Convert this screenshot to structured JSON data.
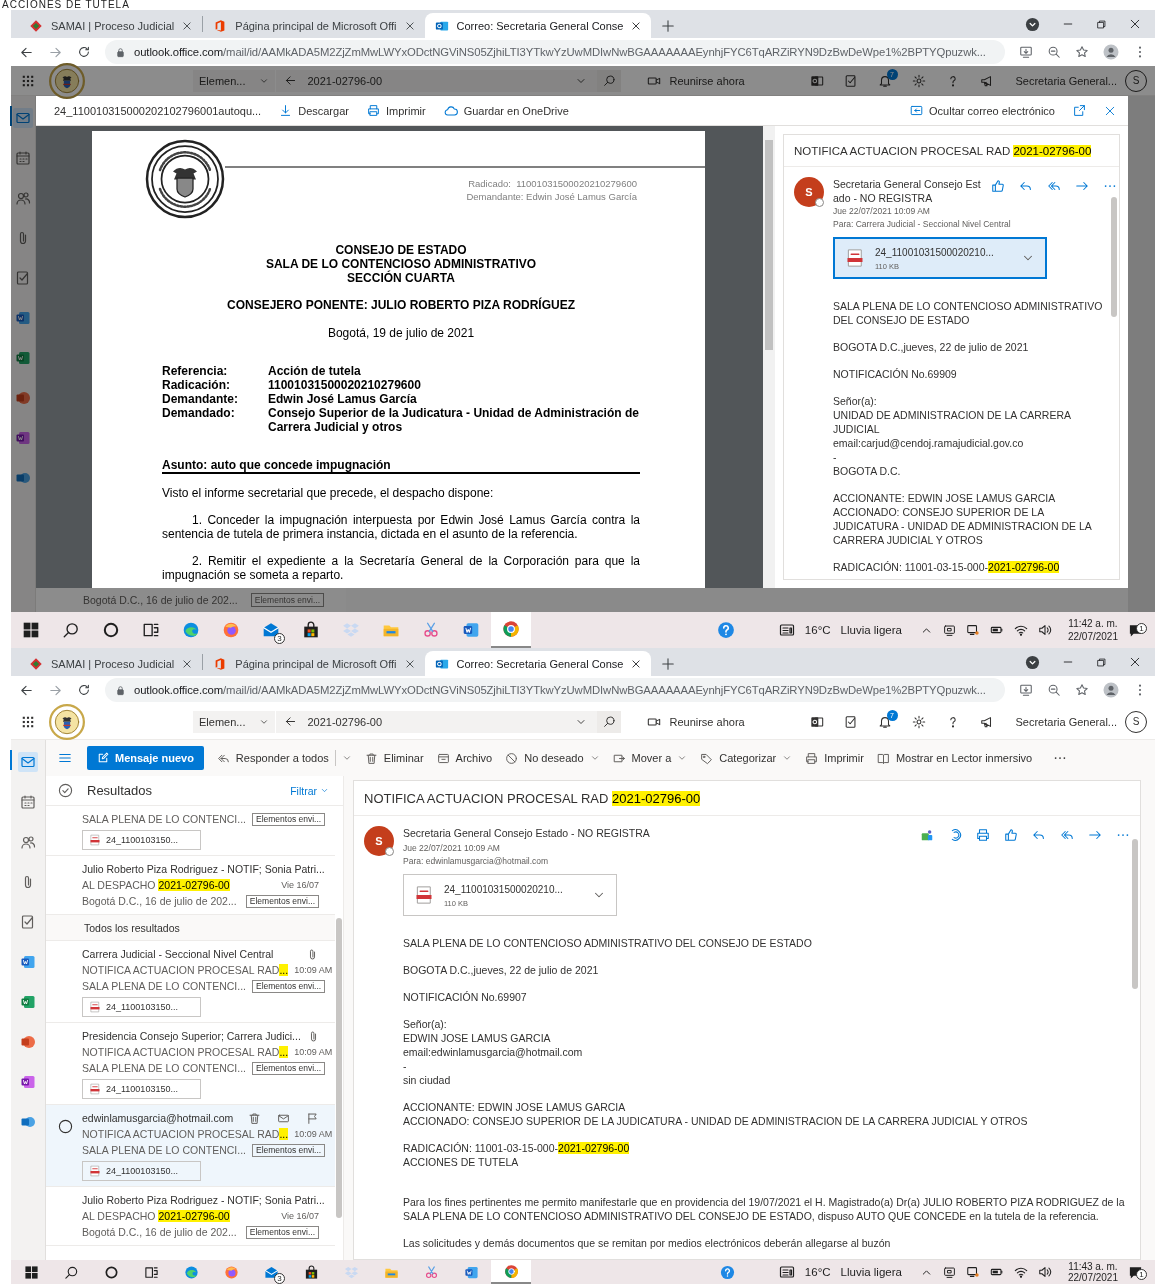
{
  "caption": "ACCIONES DE TUTELA",
  "screens": [
    {
      "browser": {
        "tabs": [
          {
            "label": "SAMAI | Proceso Judicial",
            "selected": false
          },
          {
            "label": "Página principal de Microsoft Offi",
            "selected": false
          },
          {
            "label": "Correo: Secretaria General Conse",
            "selected": true
          }
        ],
        "url_host": "outlook.office.com",
        "url_path": "/mail/id/AAMkADA5M2ZjZmMwLWYxODctNGViNS05ZjhiLTI3YTkwYzUwMDIwNwBGAAAAAAAEynhjFYC6TqARZiRYN9DzBwDeWpe1%2BPTYQpuzwk..."
      },
      "outlook": {
        "dimmed": true,
        "scope": "Elemen...",
        "search": "2021-02796-00",
        "meet": "Reunirse ahora",
        "notification_count": "7",
        "account": "Secretaria General...",
        "avatar": "S",
        "rail": [
          {
            "kind": "mail",
            "selected": true
          },
          {
            "kind": "calendar",
            "selected": false
          },
          {
            "kind": "people",
            "selected": false
          },
          {
            "kind": "files",
            "selected": false
          },
          {
            "kind": "todo",
            "selected": false
          },
          {
            "kind": "word",
            "selected": false
          },
          {
            "kind": "excel",
            "selected": false
          },
          {
            "kind": "powerpoint",
            "selected": false
          },
          {
            "kind": "onenote",
            "selected": false
          },
          {
            "kind": "yammer",
            "selected": false
          }
        ]
      },
      "viewer": {
        "file_name": "24_110010315000202102796001autoqu...",
        "download": "Descargar",
        "print": "Imprimir",
        "save": "Guardar en OneDrive",
        "hide_mail": "Ocultar correo electrónico",
        "pdf": {
          "radicado": "Radicado:  11001031500020210279600",
          "demandante": "Demandante: Edwin José Lamus García",
          "heading": [
            "CONSEJO DE ESTADO",
            "SALA DE LO CONTENCIOSO ADMINISTRATIVO",
            "SECCIÓN CUARTA"
          ],
          "ponente": "CONSEJERO PONENTE: JULIO ROBERTO PIZA RODRÍGUEZ",
          "date": "Bogotá, 19 de julio de 2021",
          "references": [
            {
              "label": "Referencia:",
              "value": "Acción de tutela"
            },
            {
              "label": "Radicación:",
              "value": "11001031500020210279600"
            },
            {
              "label": "Demandante:",
              "value": "Edwin José Lamus García"
            },
            {
              "label": "Demandado:",
              "value": "Consejo Superior de la Judicatura - Unidad de Administración de Carrera Judicial y otros"
            }
          ],
          "subject": "Asunto: auto que concede impugnación",
          "intro": "Visto el informe secretarial que precede, el despacho dispone:",
          "items": [
            {
              "number": "1.",
              "text": "Conceder la impugnación interpuesta por Edwin José Lamus García contra la sentencia de tutela de primera instancia, dictada en el asunto de la referencia."
            },
            {
              "number": "2.",
              "text": "Remitir el expediente a la Secretaría General de la Corporación para que la impugnación se someta a reparto."
            }
          ]
        },
        "mail": {
          "title": [
            {
              "text": "NOTIFICA ACTUACION PROCESAL RAD ",
              "highlighted": false
            },
            {
              "text": "2021-02796-00",
              "highlighted": true
            }
          ],
          "sender": "Secretaria General Consejo Estado - NO REGISTRA",
          "avatar": "S",
          "date": "Jue 22/07/2021 10:09 AM",
          "to_label": "Para:",
          "to": "Carrera Judicial - Seccional Nivel Central",
          "attachment": {
            "name": "24_11001031500020210...",
            "size": "110 KB",
            "selected": true
          },
          "paragraphs": [
            [
              [
                {
                  "text": "SALA PLENA DE LO CONTENCIOSO ADMINISTRATIVO DEL CONSEJO DE ESTADO",
                  "highlighted": false
                }
              ]
            ],
            [
              [
                {
                  "text": "BOGOTA D.C.,jueves, 22 de julio de 2021",
                  "highlighted": false
                }
              ]
            ],
            [
              [
                {
                  "text": "NOTIFICACIÓN No.69909",
                  "highlighted": false
                }
              ]
            ],
            [
              [
                {
                  "text": "Señor(a):",
                  "highlighted": false
                }
              ],
              [
                {
                  "text": "UNIDAD DE ADMINISTRACION DE LA CARRERA JUDICIAL",
                  "highlighted": false
                }
              ],
              [
                {
                  "text": "email:carjud@cendoj.ramajudicial.gov.co",
                  "highlighted": false
                }
              ],
              [
                {
                  "text": "-",
                  "highlighted": false
                }
              ],
              [
                {
                  "text": "BOGOTA D.C.",
                  "highlighted": false
                }
              ]
            ],
            [
              [
                {
                  "text": "ACCIONANTE: EDWIN JOSE LAMUS GARCIA",
                  "highlighted": false
                }
              ],
              [
                {
                  "text": "ACCIONADO: CONSEJO SUPERIOR DE LA JUDICATURA - UNIDAD DE ADMINISTRACION DE LA CARRERA JUDICIAL Y OTROS",
                  "highlighted": false
                }
              ]
            ],
            [
              [
                {
                  "text": "RADICACIÓN: 11001-03-15-000-",
                  "highlighted": false
                },
                {
                  "text": "2021-02796-00",
                  "highlighted": true
                }
              ]
            ]
          ]
        }
      },
      "peek": {
        "preview": "Bogotá D.C., 16 de julio de 202...",
        "folder": "Elementos envi..."
      },
      "taskbar": {
        "mail_badge": "3",
        "temperature": "16°C",
        "weather": "Lluvia ligera",
        "time": "11:42 a. m.",
        "date": "22/07/2021",
        "notification_badge": "1"
      }
    },
    {
      "browser": {
        "tabs": [
          {
            "label": "SAMAI | Proceso Judicial",
            "selected": false
          },
          {
            "label": "Página principal de Microsoft Offi",
            "selected": false
          },
          {
            "label": "Correo: Secretaria General Conse",
            "selected": true
          }
        ],
        "url_host": "outlook.office.com",
        "url_path": "/mail/id/AAMkADA5M2ZjZmMwLWYxODctNGViNS05ZjhiLTI3YTkwYzUwMDIwNwBGAAAAAAAEynhjFYC6TqARZiRYN9DzBwDeWpe1%2BPTYQpuzwk..."
      },
      "outlook": {
        "dimmed": false,
        "scope": "Elemen...",
        "search": "2021-02796-00",
        "meet": "Reunirse ahora",
        "notification_count": "7",
        "account": "Secretaria General...",
        "avatar": "S",
        "rail": [
          {
            "kind": "mail",
            "selected": true
          },
          {
            "kind": "calendar",
            "selected": false
          },
          {
            "kind": "people",
            "selected": false
          },
          {
            "kind": "files",
            "selected": false
          },
          {
            "kind": "todo",
            "selected": false
          },
          {
            "kind": "word",
            "selected": false
          },
          {
            "kind": "excel",
            "selected": false
          },
          {
            "kind": "powerpoint",
            "selected": false
          },
          {
            "kind": "onenote",
            "selected": false
          },
          {
            "kind": "yammer",
            "selected": false
          }
        ]
      },
      "command_bar": {
        "new_message": "Mensaje nuevo",
        "commands": [
          {
            "label": "Responder a todos",
            "menu": true
          },
          {
            "label": "Eliminar",
            "menu": false
          },
          {
            "label": "Archivo",
            "menu": false
          },
          {
            "label": "No deseado",
            "menu": true
          },
          {
            "label": "Mover a",
            "menu": true
          },
          {
            "label": "Categorizar",
            "menu": true
          },
          {
            "label": "Imprimir",
            "menu": false
          },
          {
            "label": "Mostrar en Lector inmersivo",
            "menu": false
          }
        ]
      },
      "list": {
        "title": "Resultados",
        "filter": "Filtrar",
        "items": [
          {
            "kind": "message",
            "selected": false,
            "preview": "SALA PLENA DE LO CONTENCI...",
            "folder": "Elementos envi...",
            "attachment": "24_1100103150..."
          },
          {
            "kind": "message",
            "selected": false,
            "sender": "Julio Roberto Piza Rodriguez - NOTIF; Sonia Patri...",
            "subject": [
              {
                "text": "AL DESPACHO ",
                "highlighted": false
              },
              {
                "text": "2021-02796-00",
                "highlighted": true
              }
            ],
            "time": "Vie 16/07",
            "preview": "Bogotá D.C., 16 de julio de 202...",
            "folder": "Elementos envi..."
          },
          {
            "kind": "section",
            "label": "Todos los resultados"
          },
          {
            "kind": "message",
            "selected": false,
            "clip": true,
            "sender": "Carrera Judicial - Seccional Nivel Central",
            "subject": [
              {
                "text": "NOTIFICA ACTUACION PROCESAL RAD",
                "highlighted": false
              },
              {
                "text": "...",
                "highlighted": true
              }
            ],
            "time": "10:09 AM",
            "preview": "SALA PLENA DE LO CONTENCI...",
            "folder": "Elementos envi...",
            "attachment": "24_1100103150..."
          },
          {
            "kind": "message",
            "selected": false,
            "clip": true,
            "sender": "Presidencia Consejo Superior; Carrera Judici...",
            "subject": [
              {
                "text": "NOTIFICA ACTUACION PROCESAL RAD",
                "highlighted": false
              },
              {
                "text": "...",
                "highlighted": true
              }
            ],
            "time": "10:09 AM",
            "preview": "SALA PLENA DE LO CONTENCI...",
            "folder": "Elementos envi...",
            "attachment": "24_1100103150..."
          },
          {
            "kind": "message",
            "selected": true,
            "sender": "edwinlamusgarcia@hotmail.com",
            "subject": [
              {
                "text": "NOTIFICA ACTUACION PROCESAL RAD",
                "highlighted": false
              },
              {
                "text": "...",
                "highlighted": true
              }
            ],
            "time": "10:09 AM",
            "preview": "SALA PLENA DE LO CONTENCI...",
            "folder": "Elementos envi...",
            "attachment": "24_1100103150..."
          },
          {
            "kind": "message",
            "selected": false,
            "sender": "Julio Roberto Piza Rodriguez - NOTIF; Sonia Patri...",
            "subject": [
              {
                "text": "AL DESPACHO ",
                "highlighted": false
              },
              {
                "text": "2021-02796-00",
                "highlighted": true
              }
            ],
            "time": "Vie 16/07",
            "preview": "Bogotá D.C., 16 de julio de 202...",
            "folder": "Elementos envi..."
          }
        ]
      },
      "mail": {
        "title": [
          {
            "text": "NOTIFICA ACTUACION PROCESAL RAD ",
            "highlighted": false
          },
          {
            "text": "2021-02796-00",
            "highlighted": true
          }
        ],
        "sender": "Secretaria General Consejo Estado - NO REGISTRA",
        "avatar": "S",
        "date": "Jue 22/07/2021 10:09 AM",
        "to_label": "Para:",
        "to": "edwinlamusgarcia@hotmail.com",
        "attachment": {
          "name": "24_11001031500020210...",
          "size": "110 KB",
          "selected": false
        },
        "paragraphs": [
          [
            [
              {
                "text": "SALA PLENA DE LO CONTENCIOSO ADMINISTRATIVO DEL CONSEJO DE ESTADO",
                "highlighted": false
              }
            ]
          ],
          [
            [
              {
                "text": "BOGOTA D.C.,jueves, 22 de julio de 2021",
                "highlighted": false
              }
            ]
          ],
          [
            [
              {
                "text": "NOTIFICACIÓN No.69907",
                "highlighted": false
              }
            ]
          ],
          [
            [
              {
                "text": "Señor(a):",
                "highlighted": false
              }
            ],
            [
              {
                "text": "EDWIN JOSE LAMUS GARCIA",
                "highlighted": false
              }
            ],
            [
              {
                "text": "email:edwinlamusgarcia@hotmail.com",
                "highlighted": false
              }
            ],
            [
              {
                "text": "-",
                "highlighted": false
              }
            ],
            [
              {
                "text": "sin ciudad",
                "highlighted": false
              }
            ]
          ],
          [
            [
              {
                "text": "ACCIONANTE: EDWIN JOSE LAMUS GARCIA",
                "highlighted": false
              }
            ],
            [
              {
                "text": "ACCIONADO: CONSEJO SUPERIOR DE LA JUDICATURA - UNIDAD DE ADMINISTRACION DE LA CARRERA JUDICIAL Y OTROS",
                "highlighted": false
              }
            ]
          ],
          [
            [
              {
                "text": "RADICACIÓN: 11001-03-15-000-",
                "highlighted": false
              },
              {
                "text": "2021-02796-00",
                "highlighted": true
              }
            ],
            [
              {
                "text": "ACCIONES DE TUTELA",
                "highlighted": false
              }
            ]
          ],
          [
            [
              {
                "text": "Para los fines pertinentes me permito manifestarle que en providencia del 19/07/2021  el H. Magistrado(a) Dr(a) JULIO ROBERTO PIZA RODRIGUEZ de la SALA PLENA DE LO CONTENCIOSO ADMINISTRATIVO DEL CONSEJO DE ESTADO, dispuso AUTO QUE CONCEDE en la tutela de la referencia.",
                "highlighted": false
              }
            ]
          ],
          [
            [
              {
                "text": "Las solicitudes y demás documentos que se remitan por medios electrónicos deberán allegarse al buzón",
                "highlighted": false
              }
            ]
          ]
        ]
      },
      "taskbar": {
        "mail_badge": "3",
        "temperature": "16°C",
        "weather": "Lluvia ligera",
        "time": "11:43 a. m.",
        "date": "22/07/2021",
        "notification_badge": "1"
      }
    }
  ]
}
